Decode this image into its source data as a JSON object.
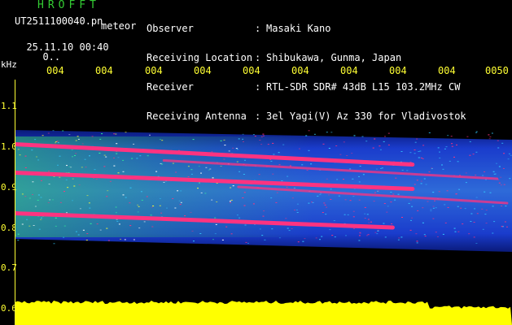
{
  "header": {
    "brand": "HROFFT",
    "filename": "UT2511100040.pn",
    "meteor_label": "meteor",
    "datetime": "25.11.10 00:40",
    "count": "0..",
    "fields": [
      {
        "label": "Observer",
        "value": "Masaki Kano"
      },
      {
        "label": "Receiving Location",
        "value": "Shibukawa, Gunma, Japan"
      },
      {
        "label": "Receiver",
        "value": "RTL-SDR SDR# 43dB L15 103.2MHz CW"
      },
      {
        "label": "Receiving Antenna",
        "value": "3el Yagi(V) Az 330 for Vladivostok"
      }
    ]
  },
  "axes": {
    "y_unit": "kHz",
    "x_ticks": [
      "004",
      "004",
      "004",
      "004",
      "004",
      "004",
      "004",
      "004",
      "004",
      "0050"
    ],
    "y_ticks": [
      "1.1",
      "1.0",
      "0.9",
      "0.8",
      "0.7",
      "0.6"
    ]
  },
  "colors": {
    "background": "#000000",
    "tick": "#ffff33",
    "title": "#33cc33",
    "trail": "#ff3380",
    "noise": "#1a3ccc",
    "signal_level": "#ffff00"
  },
  "chart_data": {
    "type": "heatmap",
    "title": "",
    "xlabel": "",
    "ylabel": "kHz",
    "ylim": [
      0.6,
      1.1
    ],
    "x_tick_labels": [
      "004",
      "004",
      "004",
      "004",
      "004",
      "004",
      "004",
      "004",
      "004",
      "0050"
    ],
    "y_tick_labels": [
      "1.1",
      "1.0",
      "0.9",
      "0.8",
      "0.7",
      "0.6"
    ],
    "noise_band_khz": [
      0.76,
      1.04
    ],
    "trails": [
      {
        "start_khz": 1.005,
        "end_khz": 0.955,
        "x_start": 0.0,
        "x_end": 0.8
      },
      {
        "start_khz": 0.935,
        "end_khz": 0.895,
        "x_start": 0.0,
        "x_end": 0.8
      },
      {
        "start_khz": 0.835,
        "end_khz": 0.8,
        "x_start": 0.0,
        "x_end": 0.76
      },
      {
        "start_khz": 0.965,
        "end_khz": 0.92,
        "x_start": 0.3,
        "x_end": 0.97
      },
      {
        "start_khz": 0.9,
        "end_khz": 0.86,
        "x_start": 0.45,
        "x_end": 0.99
      }
    ]
  }
}
